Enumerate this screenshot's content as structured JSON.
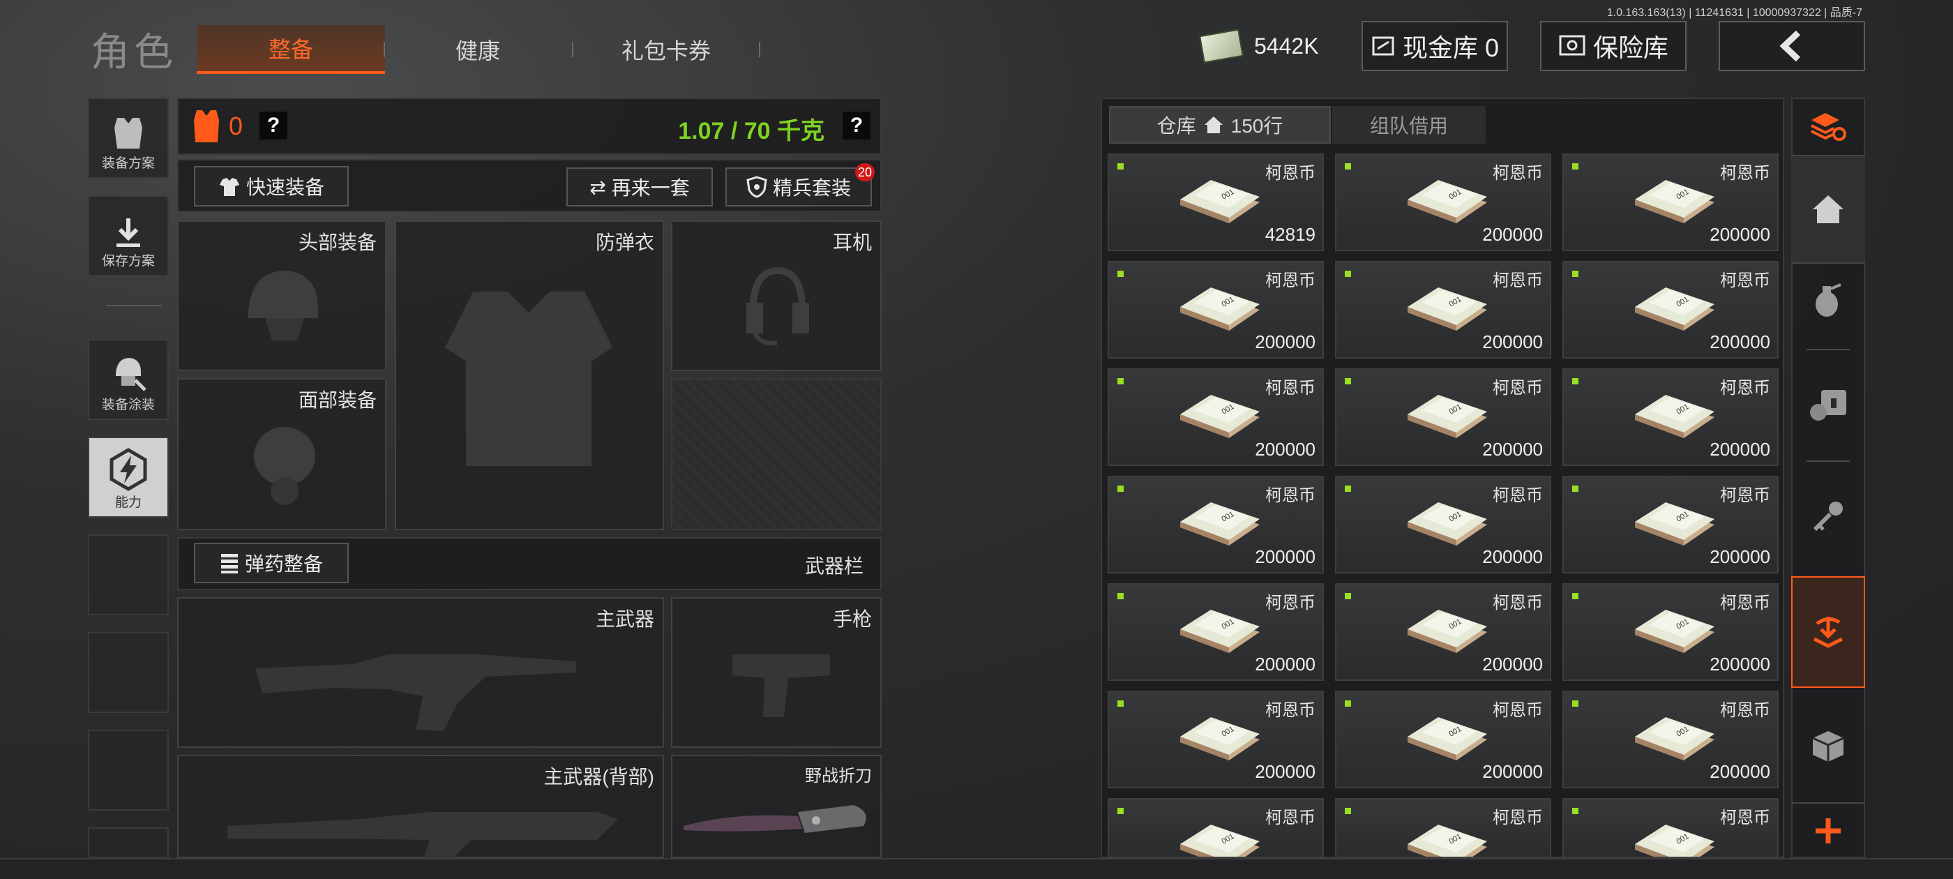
{
  "version": "1.0.163.163(13) | 11241631 | 10000937322 | 品质-7",
  "header": {
    "title": "角色",
    "tabs": [
      {
        "label": "整备",
        "active": true
      },
      {
        "label": "健康",
        "active": false
      },
      {
        "label": "礼包卡券",
        "active": false
      }
    ],
    "money": "5442K",
    "cash_vault": "现金库 0",
    "safe": "保险库",
    "back_icon": "chevron-left-icon"
  },
  "sidebar": {
    "items": [
      {
        "label": "装备方案",
        "icon": "vest-icon"
      },
      {
        "label": "保存方案",
        "icon": "download-icon"
      },
      {
        "label": "装备涂装",
        "icon": "helmet-paint-icon"
      },
      {
        "label": "能力",
        "icon": "lightning-icon"
      }
    ]
  },
  "equipment": {
    "armor_count": "0",
    "help": "?",
    "weight": "1.07 / 70 千克",
    "quick_equip": "快速装备",
    "again": "再来一套",
    "elite": "精兵套装",
    "elite_badge": "20",
    "slots": {
      "head": "头部装备",
      "vest": "防弹衣",
      "headset": "耳机",
      "face": "面部装备"
    },
    "ammo": "弹药整备",
    "weapon_bar": "武器栏",
    "weapon_slots": {
      "primary": "主武器",
      "pistol": "手枪",
      "primary_back": "主武器(背部)",
      "knife": "野战折刀"
    }
  },
  "warehouse": {
    "tab_storage": "仓库",
    "rows": "150行",
    "tab_team": "组队借用",
    "item_name": "柯恩币",
    "items": [
      "42819",
      "200000",
      "200000",
      "200000",
      "200000",
      "200000",
      "200000",
      "200000",
      "200000",
      "200000",
      "200000",
      "200000",
      "200000",
      "200000",
      "200000",
      "200000",
      "200000",
      "200000",
      "",
      "",
      ""
    ]
  },
  "colors": {
    "accent": "#ff5a1a",
    "weight_green": "#7ed321",
    "rarity_dot": "#9adf22"
  }
}
